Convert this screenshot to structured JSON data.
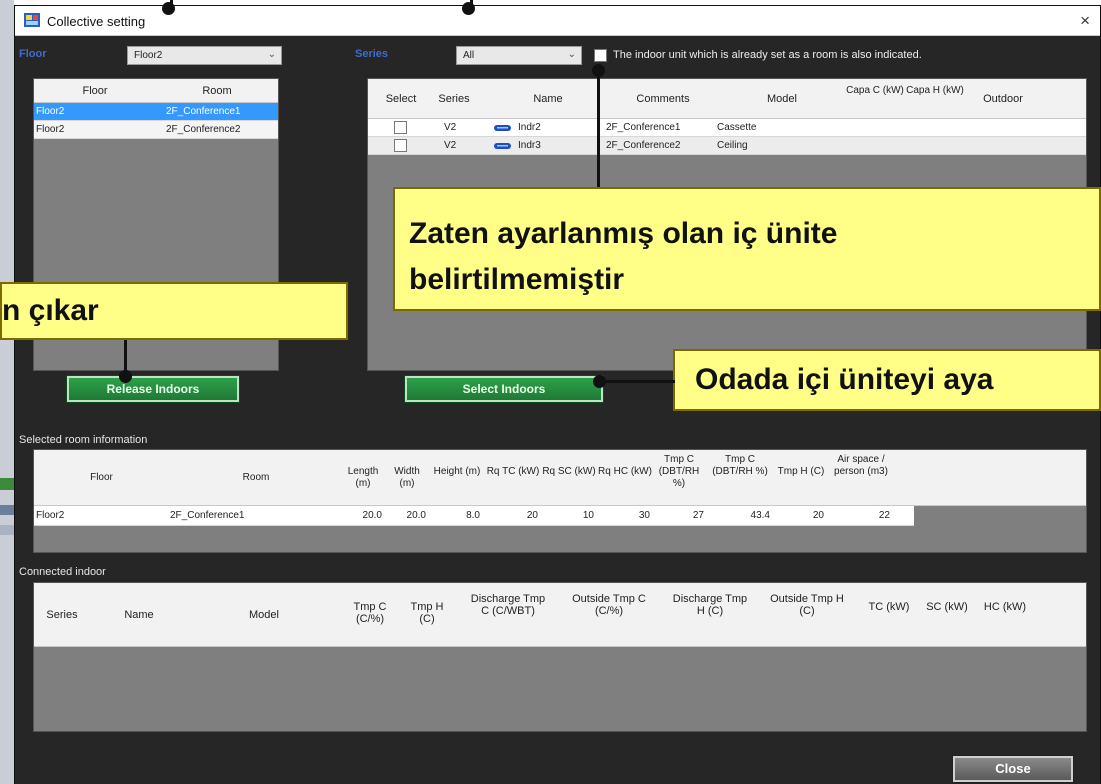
{
  "window": {
    "title": "Collective setting",
    "close_glyph": "×"
  },
  "filters": {
    "floor_label": "Floor",
    "floor_value": "Floor2",
    "series_label": "Series",
    "series_value": "All",
    "indicate_checkbox_label": "The indoor unit which is already set as a room is also indicated.",
    "indicate_checked": false
  },
  "room_list": {
    "columns": [
      "Floor",
      "Room"
    ],
    "rows": [
      {
        "floor": "Floor2",
        "room": "2F_Conference1",
        "selected": true
      },
      {
        "floor": "Floor2",
        "room": "2F_Conference2",
        "selected": false
      }
    ]
  },
  "indoor_list": {
    "columns": [
      "Select",
      "Series",
      "Name",
      "Comments",
      "Model",
      "Capa C (kW)",
      "Capa H (kW)",
      "Outdoor"
    ],
    "rows": [
      {
        "selected": false,
        "series": "V2",
        "name": "Indr2",
        "comments": "2F_Conference1",
        "model": "Cassette",
        "capa_c": "",
        "capa_h": "",
        "outdoor": ""
      },
      {
        "selected": false,
        "series": "V2",
        "name": "Indr3",
        "comments": "2F_Conference2",
        "model": "Ceiling",
        "capa_c": "",
        "capa_h": "",
        "outdoor": ""
      }
    ]
  },
  "buttons": {
    "release_indoors": "Release Indoors",
    "select_indoors": "Select Indoors",
    "close": "Close"
  },
  "selected_room_info": {
    "label": "Selected room information",
    "columns": [
      "Floor",
      "Room",
      "Length (m)",
      "Width (m)",
      "Height (m)",
      "Rq TC (kW)",
      "Rq SC (kW)",
      "Rq HC (kW)",
      "Tmp C (DBT/RH %)",
      "Tmp C (DBT/RH %)",
      "Tmp H (C)",
      "Air space / person (m3)"
    ],
    "row": {
      "floor": "Floor2",
      "room": "2F_Conference1",
      "length": "20.0",
      "width": "20.0",
      "height": "8.0",
      "rq_tc": "20",
      "rq_sc": "10",
      "rq_hc": "30",
      "tmp_c1": "27",
      "tmp_c2": "43.4",
      "tmp_h": "20",
      "air_space": "22"
    }
  },
  "connected_indoor": {
    "label": "Connected indoor",
    "columns": [
      "Series",
      "Name",
      "Model",
      "Tmp C (C/%)",
      "Tmp H (C)",
      "Discharge Tmp C (C/WBT)",
      "Outside Tmp C (C/%)",
      "Discharge Tmp H (C)",
      "Outside Tmp H (C)",
      "TC (kW)",
      "SC (kW)",
      "HC (kW)"
    ]
  },
  "callouts": {
    "not_indicated_line1": "Zaten ayarlanmış olan iç ünite",
    "not_indicated_line2": "belirtilmemiştir",
    "release_partial": "n çıkar",
    "select_partial": "Odada içi üniteyi aya"
  },
  "colors": {
    "accent_blue": "#3f6ccc",
    "selected_row": "#3399ff",
    "button_green": "#1e7a35",
    "callout_yellow": "#ffff88"
  }
}
